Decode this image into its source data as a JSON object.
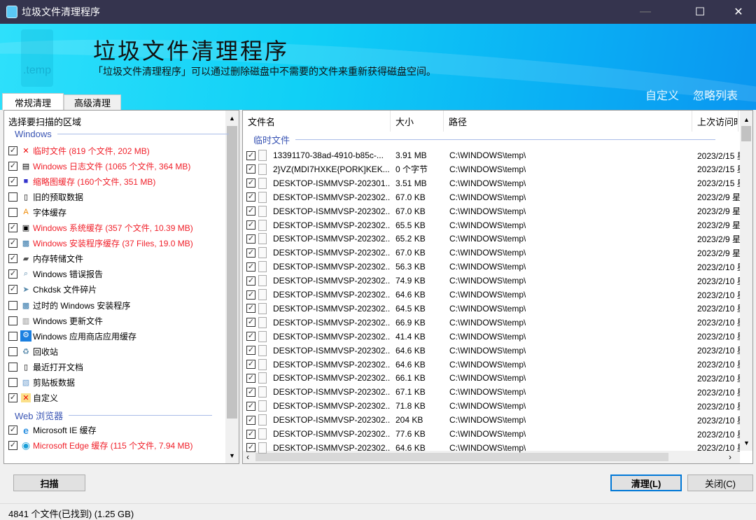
{
  "window": {
    "title": "垃圾文件清理程序"
  },
  "banner": {
    "title": "垃圾文件清理程序",
    "subtitle": "「垃圾文件清理程序」可以通过删除磁盘中不需要的文件来重新获得磁盘空间。",
    "logo_text": ".temp",
    "link_custom": "自定义",
    "link_ignore": "忽略列表"
  },
  "tabs": [
    {
      "label": "常规清理",
      "active": true
    },
    {
      "label": "高级清理",
      "active": false
    }
  ],
  "left": {
    "header": "选择要扫描的区域",
    "groups": [
      {
        "label": "Windows",
        "items": [
          {
            "label": "临时文件 (819 个文件, 202 MB)",
            "checked": true,
            "highlight": true,
            "icon": "temp-files-icon"
          },
          {
            "label": "Windows 日志文件 (1065 个文件, 364 MB)",
            "checked": true,
            "highlight": true,
            "icon": "log-file-icon"
          },
          {
            "label": "缩略图缓存 (160个文件, 351 MB)",
            "checked": true,
            "highlight": true,
            "icon": "thumbnail-icon"
          },
          {
            "label": "旧的预取数据",
            "checked": false,
            "highlight": false,
            "icon": "prefetch-icon"
          },
          {
            "label": "字体缓存",
            "checked": false,
            "highlight": false,
            "icon": "font-icon"
          },
          {
            "label": "Windows 系统缓存 (357 个文件, 10.39 MB)",
            "checked": true,
            "highlight": true,
            "icon": "system-cache-icon"
          },
          {
            "label": "Windows 安装程序缓存 (37 Files, 19.0 MB)",
            "checked": true,
            "highlight": true,
            "icon": "installer-icon"
          },
          {
            "label": "内存转储文件",
            "checked": true,
            "highlight": false,
            "icon": "memory-dump-icon"
          },
          {
            "label": "Windows 错误报告",
            "checked": true,
            "highlight": false,
            "icon": "error-report-icon"
          },
          {
            "label": "Chkdsk 文件碎片",
            "checked": true,
            "highlight": false,
            "icon": "chkdsk-icon"
          },
          {
            "label": "过时的 Windows 安装程序",
            "checked": false,
            "highlight": false,
            "icon": "installer-icon"
          },
          {
            "label": "Windows 更新文件",
            "checked": false,
            "highlight": false,
            "icon": "update-icon"
          },
          {
            "label": "Windows 应用商店应用缓存",
            "checked": false,
            "highlight": false,
            "icon": "gear-icon"
          },
          {
            "label": "回收站",
            "checked": false,
            "highlight": false,
            "icon": "recycle-bin-icon"
          },
          {
            "label": "最近打开文档",
            "checked": false,
            "highlight": false,
            "icon": "recent-docs-icon"
          },
          {
            "label": "剪贴板数据",
            "checked": false,
            "highlight": false,
            "icon": "clipboard-icon"
          },
          {
            "label": "自定义",
            "checked": true,
            "highlight": false,
            "icon": "custom-folder-icon"
          }
        ]
      },
      {
        "label": "Web 浏览器",
        "items": [
          {
            "label": "Microsoft IE 缓存",
            "checked": true,
            "highlight": false,
            "icon": "ie-icon"
          },
          {
            "label": "Microsoft Edge 缓存 (115 个文件, 7.94 MB)",
            "checked": true,
            "highlight": true,
            "icon": "edge-icon"
          }
        ]
      }
    ]
  },
  "right": {
    "columns": [
      "文件名",
      "大小",
      "路径",
      "上次访问时"
    ],
    "group": "临时文件",
    "rows": [
      {
        "name": "13391170-38ad-4910-b85c-...",
        "size": "3.91 MB",
        "path": "C:\\WINDOWS\\temp\\",
        "date": "2023/2/15 星"
      },
      {
        "name": "2}VZ(MDI7HXKE{PORK]KEK...",
        "size": "0 个字节",
        "path": "C:\\WINDOWS\\temp\\",
        "date": "2023/2/15 星"
      },
      {
        "name": "DESKTOP-ISMMVSP-202301...",
        "size": "3.51 MB",
        "path": "C:\\WINDOWS\\temp\\",
        "date": "2023/2/15 星"
      },
      {
        "name": "DESKTOP-ISMMVSP-202302...",
        "size": "67.0 KB",
        "path": "C:\\WINDOWS\\temp\\",
        "date": "2023/2/9 星"
      },
      {
        "name": "DESKTOP-ISMMVSP-202302...",
        "size": "67.0 KB",
        "path": "C:\\WINDOWS\\temp\\",
        "date": "2023/2/9 星"
      },
      {
        "name": "DESKTOP-ISMMVSP-202302...",
        "size": "65.5 KB",
        "path": "C:\\WINDOWS\\temp\\",
        "date": "2023/2/9 星"
      },
      {
        "name": "DESKTOP-ISMMVSP-202302...",
        "size": "65.2 KB",
        "path": "C:\\WINDOWS\\temp\\",
        "date": "2023/2/9 星"
      },
      {
        "name": "DESKTOP-ISMMVSP-202302...",
        "size": "67.0 KB",
        "path": "C:\\WINDOWS\\temp\\",
        "date": "2023/2/9 星"
      },
      {
        "name": "DESKTOP-ISMMVSP-202302...",
        "size": "56.3 KB",
        "path": "C:\\WINDOWS\\temp\\",
        "date": "2023/2/10 星"
      },
      {
        "name": "DESKTOP-ISMMVSP-202302...",
        "size": "74.9 KB",
        "path": "C:\\WINDOWS\\temp\\",
        "date": "2023/2/10 星"
      },
      {
        "name": "DESKTOP-ISMMVSP-202302...",
        "size": "64.6 KB",
        "path": "C:\\WINDOWS\\temp\\",
        "date": "2023/2/10 星"
      },
      {
        "name": "DESKTOP-ISMMVSP-202302...",
        "size": "64.5 KB",
        "path": "C:\\WINDOWS\\temp\\",
        "date": "2023/2/10 星"
      },
      {
        "name": "DESKTOP-ISMMVSP-202302...",
        "size": "66.9 KB",
        "path": "C:\\WINDOWS\\temp\\",
        "date": "2023/2/10 星"
      },
      {
        "name": "DESKTOP-ISMMVSP-202302...",
        "size": "41.4 KB",
        "path": "C:\\WINDOWS\\temp\\",
        "date": "2023/2/10 星"
      },
      {
        "name": "DESKTOP-ISMMVSP-202302...",
        "size": "64.6 KB",
        "path": "C:\\WINDOWS\\temp\\",
        "date": "2023/2/10 星"
      },
      {
        "name": "DESKTOP-ISMMVSP-202302...",
        "size": "64.6 KB",
        "path": "C:\\WINDOWS\\temp\\",
        "date": "2023/2/10 星"
      },
      {
        "name": "DESKTOP-ISMMVSP-202302...",
        "size": "66.1 KB",
        "path": "C:\\WINDOWS\\temp\\",
        "date": "2023/2/10 星"
      },
      {
        "name": "DESKTOP-ISMMVSP-202302...",
        "size": "67.1 KB",
        "path": "C:\\WINDOWS\\temp\\",
        "date": "2023/2/10 星"
      },
      {
        "name": "DESKTOP-ISMMVSP-202302...",
        "size": "71.8 KB",
        "path": "C:\\WINDOWS\\temp\\",
        "date": "2023/2/10 星"
      },
      {
        "name": "DESKTOP-ISMMVSP-202302...",
        "size": "204 KB",
        "path": "C:\\WINDOWS\\temp\\",
        "date": "2023/2/10 星"
      },
      {
        "name": "DESKTOP-ISMMVSP-202302...",
        "size": "77.6 KB",
        "path": "C:\\WINDOWS\\temp\\",
        "date": "2023/2/10 星"
      },
      {
        "name": "DESKTOP-ISMMVSP-202302...",
        "size": "64.6 KB",
        "path": "C:\\WINDOWS\\temp\\",
        "date": "2023/2/10 星"
      }
    ]
  },
  "buttons": {
    "scan": "扫描",
    "clean": "清理(L)",
    "close": "关闭(C)"
  },
  "status": "4841  个文件(已找到) (1.25 GB)",
  "colors": {
    "titlebar": "#35344e",
    "highlight": "#f0202a",
    "group": "#3a55b4"
  }
}
